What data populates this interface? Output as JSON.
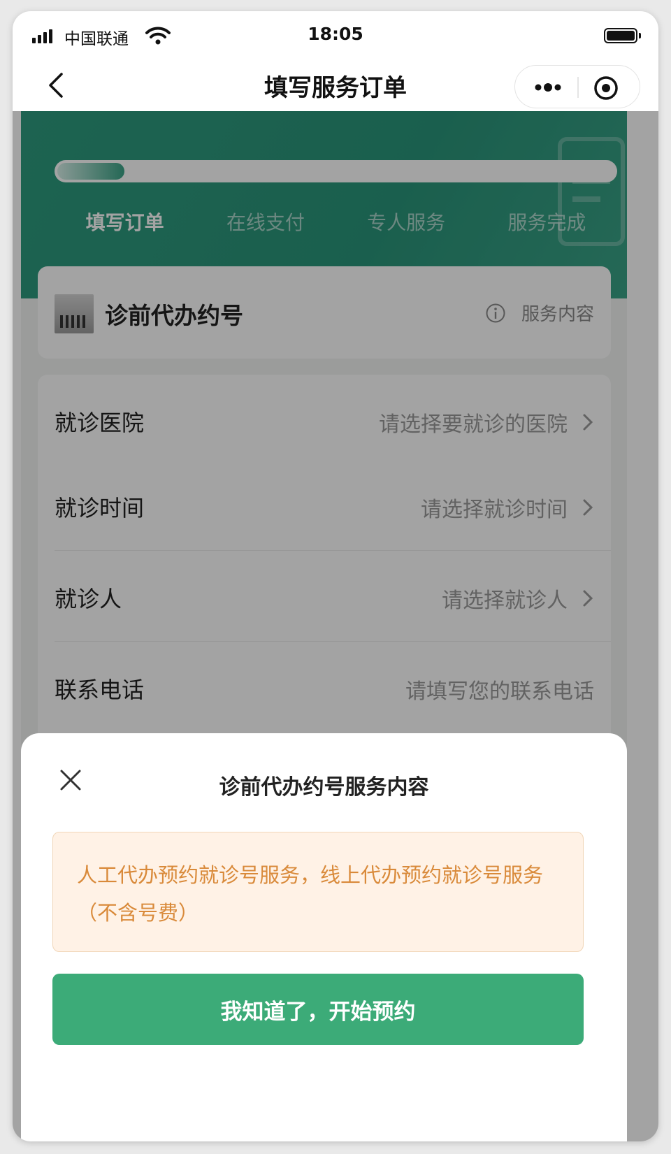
{
  "status_bar": {
    "carrier": "中国联通",
    "time": "18:05"
  },
  "nav": {
    "title": "填写服务订单"
  },
  "progress": {
    "fraction": 0.12,
    "steps": [
      {
        "label": "填写订单",
        "active": true
      },
      {
        "label": "在线支付",
        "active": false
      },
      {
        "label": "专人服务",
        "active": false
      },
      {
        "label": "服务完成",
        "active": false
      }
    ]
  },
  "service": {
    "name": "诊前代办约号",
    "link_label": "服务内容"
  },
  "form": {
    "rows": [
      {
        "label": "就诊医院",
        "placeholder": "请选择要就诊的医院"
      },
      {
        "label": "就诊时间",
        "placeholder": "请选择就诊时间"
      },
      {
        "label": "就诊人",
        "placeholder": "请选择就诊人"
      },
      {
        "label": "联系电话",
        "placeholder": "请填写您的联系电话"
      }
    ]
  },
  "sheet": {
    "title": "诊前代办约号服务内容",
    "notice": "人工代办预约就诊号服务，线上代办预约就诊号服务（不含号费）",
    "confirm_label": "我知道了，开始预约"
  },
  "colors": {
    "brand_green": "#3cab78",
    "hero_green": "#2e9c7f",
    "notice_text": "#d98a3a",
    "notice_bg": "#fff2e6"
  }
}
